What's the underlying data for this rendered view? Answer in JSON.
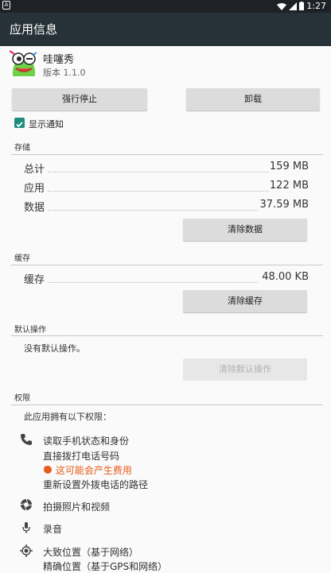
{
  "status_bar": {
    "time": "1:27"
  },
  "action_bar": {
    "title": "应用信息"
  },
  "app": {
    "name": "哇噻秀",
    "version": "版本 1.1.0"
  },
  "buttons": {
    "force_stop": "强行停止",
    "uninstall": "卸载"
  },
  "show_notifications": {
    "label": "显示通知",
    "checked": true
  },
  "storage": {
    "title": "存储",
    "rows": [
      {
        "label": "总计",
        "value": "159 MB"
      },
      {
        "label": "应用",
        "value": "122 MB"
      },
      {
        "label": "数据",
        "value": "37.59 MB"
      }
    ],
    "clear_data": "清除数据"
  },
  "cache": {
    "title": "缓存",
    "rows": [
      {
        "label": "缓存",
        "value": "48.00 KB"
      }
    ],
    "clear_cache": "清除缓存"
  },
  "defaults": {
    "title": "默认操作",
    "text": "没有默认操作。",
    "clear_defaults": "清除默认操作"
  },
  "permissions": {
    "title": "权限",
    "intro": "此应用拥有以下权限：",
    "groups": [
      {
        "icon": "phone-icon",
        "lines": [
          "读取手机状态和身份",
          "直接拨打电话号码"
        ],
        "cost": "这可能会产生费用",
        "extra": "重新设置外拨电话的路径"
      },
      {
        "icon": "camera-icon",
        "lines": [
          "拍摄照片和视频"
        ]
      },
      {
        "icon": "mic-icon",
        "lines": [
          "录音"
        ]
      },
      {
        "icon": "location-icon",
        "lines": [
          "大致位置（基于网络）",
          "精确位置（基于GPS和网络）"
        ]
      }
    ]
  },
  "colors": {
    "accent": "#1d8d80",
    "action_bar": "#263238",
    "status_bar": "#1e2226",
    "cost_warning": "#e65c1b"
  }
}
